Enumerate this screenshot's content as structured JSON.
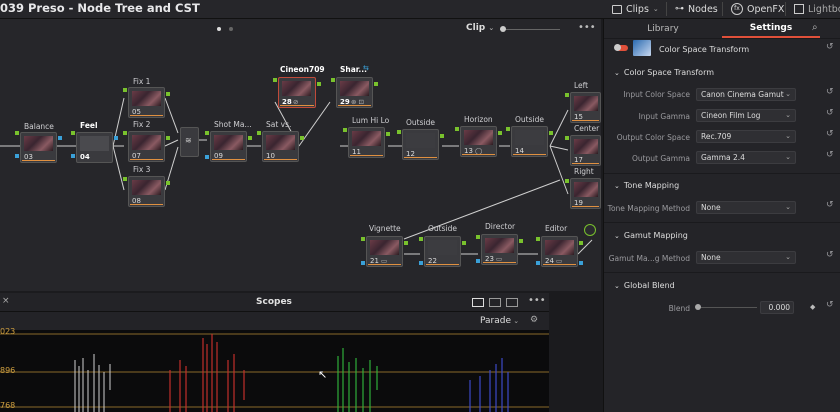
{
  "topbar": {
    "title": "039 Preso - Node Tree and CST",
    "buttons": [
      {
        "label": "Clips",
        "icon": "clips-icon"
      },
      {
        "label": "Nodes",
        "icon": "nodes-icon"
      },
      {
        "label": "OpenFX",
        "icon": "fx-icon"
      },
      {
        "label": "Lightbox",
        "icon": "lightbox-icon"
      }
    ]
  },
  "node_editor": {
    "mode": "Clip",
    "nodes": [
      {
        "label": "Balance",
        "num": "03"
      },
      {
        "label": "Feel",
        "num": "04"
      },
      {
        "label": "Fix 1",
        "num": "05"
      },
      {
        "label": "Fix 2",
        "num": "07"
      },
      {
        "label": "Fix 3",
        "num": "08"
      },
      {
        "label": "Shot Ma...",
        "num": "09"
      },
      {
        "label": "Sat vs.",
        "num": "10"
      },
      {
        "label": "Cineon709",
        "num": "28"
      },
      {
        "label": "Shar...",
        "num": "29"
      },
      {
        "label": "Lum Hi Lo",
        "num": "11"
      },
      {
        "label": "Outside",
        "num": "12"
      },
      {
        "label": "Horizon",
        "num": "13"
      },
      {
        "label": "Outside",
        "num": "14"
      },
      {
        "label": "Left",
        "num": "15"
      },
      {
        "label": "Center",
        "num": "17"
      },
      {
        "label": "Right",
        "num": "19"
      },
      {
        "label": "Vignette",
        "num": "21"
      },
      {
        "label": "Outside",
        "num": "22"
      },
      {
        "label": "Director",
        "num": "23"
      },
      {
        "label": "Editor",
        "num": "24"
      }
    ]
  },
  "scopes": {
    "title": "Scopes",
    "mode": "Parade",
    "ticks": [
      "023",
      "896",
      "768"
    ]
  },
  "panel": {
    "tabs": [
      "Library",
      "Settings"
    ],
    "effect_name": "Color Space Transform",
    "sections": {
      "cst": "Color Space Transform",
      "tone": "Tone Mapping",
      "gamut": "Gamut Mapping",
      "blend": "Global Blend"
    },
    "fields": {
      "input_color_space": {
        "label": "Input Color Space",
        "value": "Canon Cinema Gamut"
      },
      "input_gamma": {
        "label": "Input Gamma",
        "value": "Cineon Film Log"
      },
      "output_color_space": {
        "label": "Output Color Space",
        "value": "Rec.709"
      },
      "output_gamma": {
        "label": "Output Gamma",
        "value": "Gamma 2.4"
      },
      "tone_mapping_method": {
        "label": "Tone Mapping Method",
        "value": "None"
      },
      "gamut_mapping_method": {
        "label": "Gamut Ma...g Method",
        "value": "None"
      },
      "blend": {
        "label": "Blend",
        "value": "0.000"
      }
    }
  },
  "colors": {
    "accent_orange": "#e0503a",
    "input_green": "#79c22d",
    "output_blue": "#3aa0d8"
  }
}
